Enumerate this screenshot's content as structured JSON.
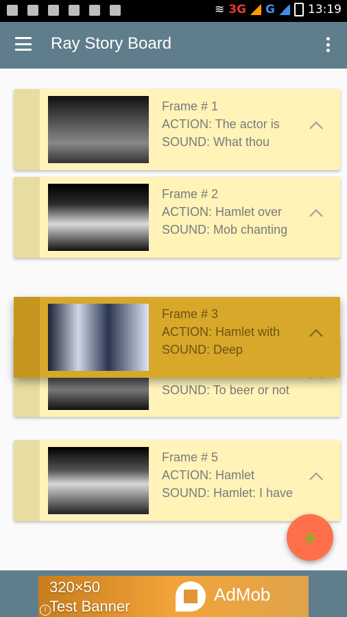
{
  "status": {
    "net1": "3G",
    "net2": "G",
    "time": "13:19"
  },
  "appbar": {
    "title": "Ray Story Board"
  },
  "cards": [
    {
      "frame": "Frame # 1",
      "action": "ACTION: The actor is",
      "sound": "SOUND: What thou"
    },
    {
      "frame": "Frame # 2",
      "action": "ACTION: Hamlet over",
      "sound": "SOUND: Mob chanting"
    },
    {
      "frame": "Frame # 3",
      "action": "ACTION: Hamlet with",
      "sound": "SOUND: Deep"
    },
    {
      "sound": "SOUND: To beer or not"
    },
    {
      "frame": "Frame # 5",
      "action": "ACTION: Hamlet",
      "sound": "SOUND: Hamlet: I have"
    }
  ],
  "fab": {
    "label": "+"
  },
  "ad": {
    "line1": "320×50",
    "line2": "Test Banner",
    "brand": "AdMob"
  }
}
